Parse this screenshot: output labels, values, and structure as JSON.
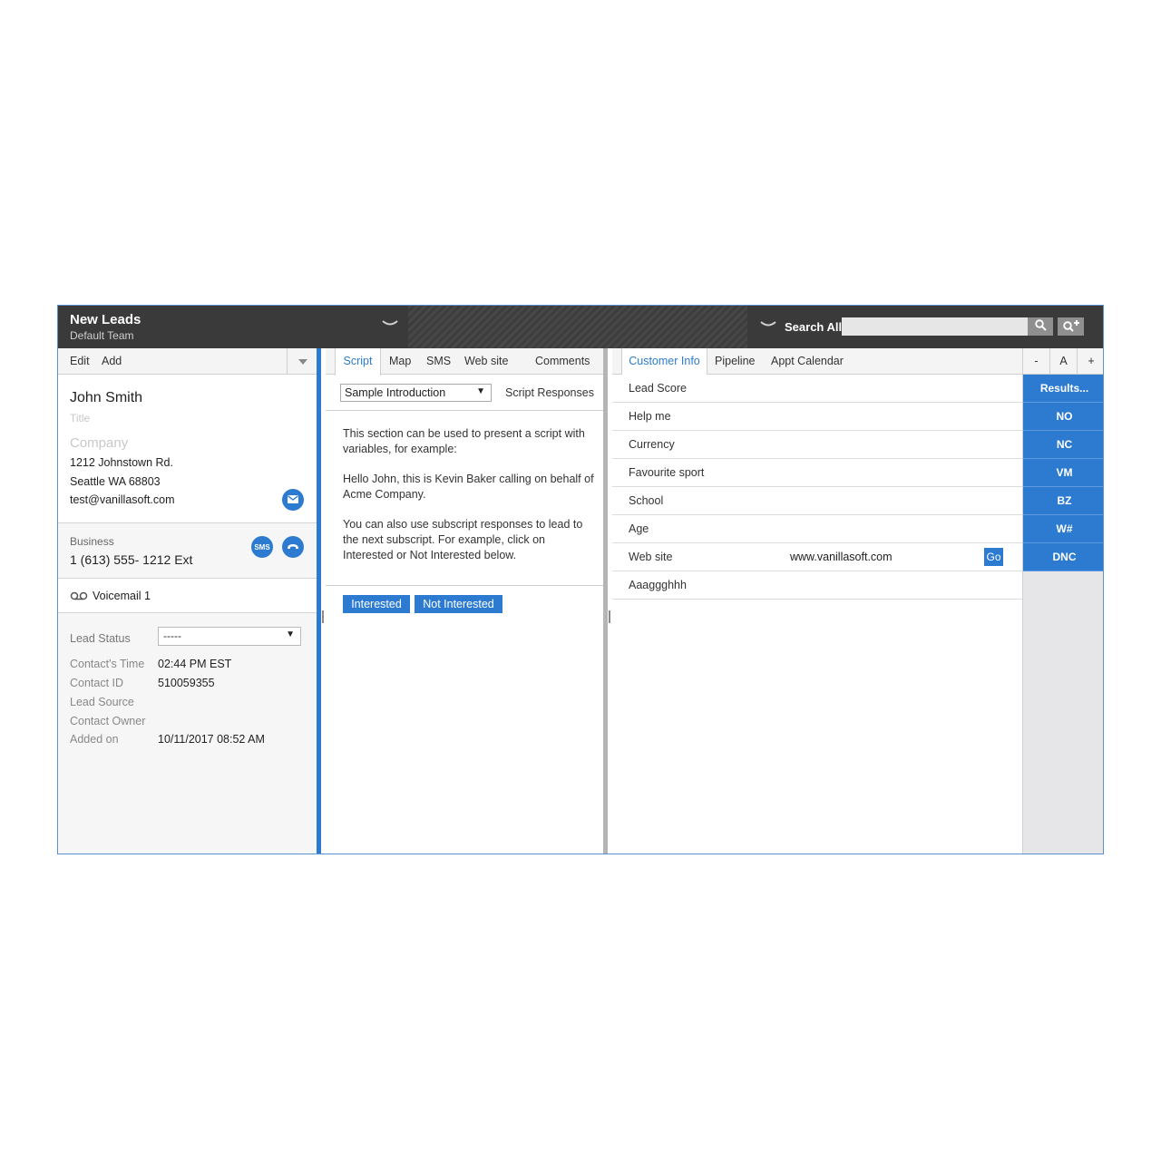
{
  "header": {
    "queue_title": "New Leads",
    "queue_subtitle": "Default Team",
    "search_label": "Search All",
    "search_placeholder": ""
  },
  "left_panel": {
    "toolbar": {
      "edit": "Edit",
      "add": "Add"
    },
    "contact": {
      "name": "John Smith",
      "title_placeholder": "Title",
      "company_placeholder": "Company",
      "address1": "1212 Johnstown Rd.",
      "address2": "Seattle  WA  68803",
      "email": "test@vanillasoft.com"
    },
    "phone": {
      "label": "Business",
      "number": "1 (613) 555- 1212   Ext",
      "sms_label": "SMS"
    },
    "voicemail": "Voicemail 1",
    "lead_status": {
      "label": "Lead Status",
      "value": "-----"
    },
    "fields": [
      {
        "label": "Contact's Time",
        "value": "02:44 PM EST"
      },
      {
        "label": "Contact ID",
        "value": "510059355"
      },
      {
        "label": "Lead Source",
        "value": ""
      },
      {
        "label": "Contact Owner",
        "value": ""
      },
      {
        "label": "Added on",
        "value": "10/11/2017 08:52 AM"
      }
    ]
  },
  "middle_panel": {
    "tabs": [
      "Script",
      "Map",
      "SMS",
      "Web site",
      "Comments"
    ],
    "active_tab": "Script",
    "script_select": "Sample Introduction",
    "script_responses": "Script Responses",
    "paragraphs": [
      "This section can be used to present a script with variables, for example:",
      "Hello John, this is Kevin Baker calling on behalf of Acme Company.",
      "You can also use subscript responses to lead to the next subscript. For example, click on Interested or Not Interested below."
    ],
    "buttons": {
      "interested": "Interested",
      "not_interested": "Not Interested"
    }
  },
  "right_panel": {
    "tabs": [
      "Customer Info",
      "Pipeline",
      "Appt Calendar"
    ],
    "active_tab": "Customer Info",
    "font_controls": [
      "-",
      "A",
      "+"
    ],
    "rows": [
      {
        "label": "Lead Score",
        "value": ""
      },
      {
        "label": "Help me",
        "value": ""
      },
      {
        "label": "Currency",
        "value": ""
      },
      {
        "label": "Favourite sport",
        "value": ""
      },
      {
        "label": "School",
        "value": ""
      },
      {
        "label": "Age",
        "value": ""
      },
      {
        "label": "Web site",
        "value": "www.vanillasoft.com",
        "action": "Go"
      },
      {
        "label": "Aaaggghhh",
        "value": ""
      }
    ],
    "results": [
      "Results...",
      "NO",
      "NC",
      "VM",
      "BZ",
      "W#",
      "DNC"
    ]
  },
  "colors": {
    "accent": "#2c7bd1",
    "topbar": "#3d3d3d",
    "results_bg": "#e6e6e8"
  }
}
